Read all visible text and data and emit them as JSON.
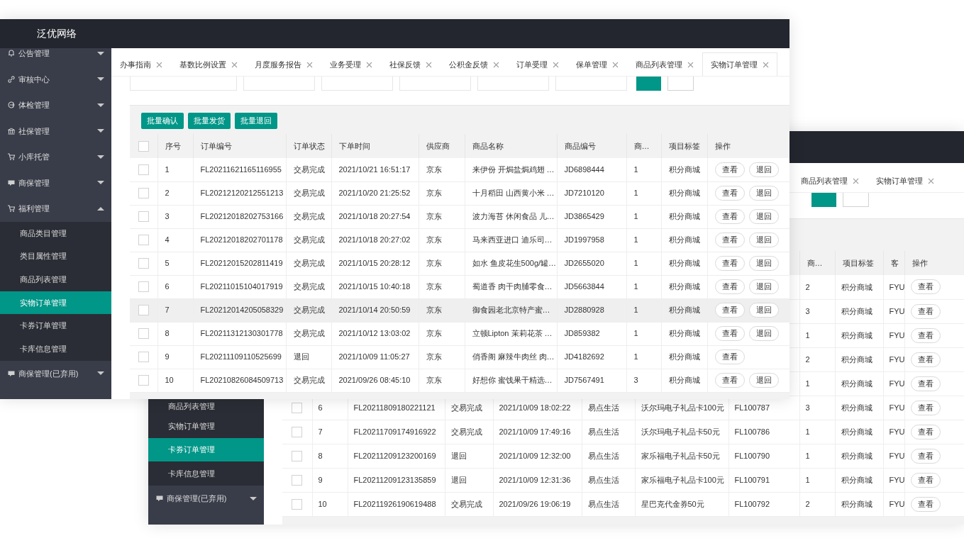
{
  "front_window": {
    "title": "泛优网络",
    "sidebar": [
      {
        "label": "公告管理",
        "expanded": false,
        "selected": false
      },
      {
        "label": "审核中心",
        "expanded": false,
        "selected": false
      },
      {
        "label": "体检管理",
        "expanded": false,
        "selected": false
      },
      {
        "label": "社保管理",
        "expanded": false,
        "selected": false
      },
      {
        "label": "小库托管",
        "expanded": false,
        "selected": false
      },
      {
        "label": "商保管理",
        "expanded": false,
        "selected": false
      },
      {
        "label": "福利管理",
        "expanded": true,
        "selected": false,
        "children": [
          {
            "label": "商品类目管理",
            "selected": false
          },
          {
            "label": "类目属性管理",
            "selected": false
          },
          {
            "label": "商品列表管理",
            "selected": false
          },
          {
            "label": "实物订单管理",
            "selected": true
          },
          {
            "label": "卡券订单管理",
            "selected": false
          },
          {
            "label": "卡库信息管理",
            "selected": false
          }
        ]
      },
      {
        "label": "商保管理(已弃用)",
        "expanded": false,
        "selected": false
      }
    ],
    "tabs": [
      {
        "label": "办事指南",
        "selected": false
      },
      {
        "label": "基数比例设置",
        "selected": false
      },
      {
        "label": "月度服务报告",
        "selected": false
      },
      {
        "label": "业务受理",
        "selected": false
      },
      {
        "label": "社保反馈",
        "selected": false
      },
      {
        "label": "公积金反馈",
        "selected": false
      },
      {
        "label": "订单受理",
        "selected": false
      },
      {
        "label": "保单管理",
        "selected": false
      },
      {
        "label": "商品列表管理",
        "selected": false
      },
      {
        "label": "实物订单管理",
        "selected": true
      }
    ],
    "toolbar": [
      "批量确认",
      "批量发货",
      "批量退回"
    ],
    "table": {
      "select_all_checked": false,
      "columns": [
        "序号",
        "订单编号",
        "订单状态",
        "下单时间",
        "供应商",
        "商品名称",
        "商品编号",
        "商…",
        "项目标签",
        "操作"
      ],
      "rows": [
        {
          "checked": false,
          "highlighted": false,
          "cells": [
            "1",
            "FL20211621165116955",
            "交易完成",
            "2021/10/21 16:51:17",
            "京东",
            "来伊份 开焗盐焗鸡翅 …",
            "JD6898444",
            "1",
            "积分商城"
          ],
          "actions": [
            "查看",
            "退回"
          ]
        },
        {
          "checked": false,
          "highlighted": false,
          "cells": [
            "2",
            "FL20212120212551213",
            "交易完成",
            "2021/10/20 21:25:52",
            "京东",
            "十月稻田 山西黄小米 …",
            "JD7210120",
            "1",
            "积分商城"
          ],
          "actions": [
            "查看",
            "退回"
          ]
        },
        {
          "checked": false,
          "highlighted": false,
          "cells": [
            "3",
            "FL20212018202753166",
            "交易完成",
            "2021/10/18 20:27:54",
            "京东",
            "波力海苔 休闲食品 儿…",
            "JD3865429",
            "1",
            "积分商城"
          ],
          "actions": [
            "查看",
            "退回"
          ]
        },
        {
          "checked": false,
          "highlighted": false,
          "cells": [
            "4",
            "FL20212018202701178",
            "交易完成",
            "2021/10/18 20:27:02",
            "京东",
            "马来西亚进口 迪乐司…",
            "JD1997958",
            "1",
            "积分商城"
          ],
          "actions": [
            "查看",
            "退回"
          ]
        },
        {
          "checked": false,
          "highlighted": false,
          "cells": [
            "5",
            "FL20212015202811419",
            "交易完成",
            "2021/10/15 20:28:12",
            "京东",
            "如水 鱼皮花生500g/罐…",
            "JD2655020",
            "1",
            "积分商城"
          ],
          "actions": [
            "查看",
            "退回"
          ]
        },
        {
          "checked": false,
          "highlighted": false,
          "cells": [
            "6",
            "FL20211015104017919",
            "交易完成",
            "2021/10/15 10:40:18",
            "京东",
            "蜀道香 肉干肉脯零食…",
            "JD5663844",
            "1",
            "积分商城"
          ],
          "actions": [
            "查看",
            "退回"
          ]
        },
        {
          "checked": false,
          "highlighted": true,
          "cells": [
            "7",
            "FL20212014205058329",
            "交易完成",
            "2021/10/14 20:50:59",
            "京东",
            "御食园老北京特产蜜…",
            "JD2880928",
            "1",
            "积分商城"
          ],
          "actions": [
            "查看",
            "退回"
          ]
        },
        {
          "checked": false,
          "highlighted": false,
          "cells": [
            "8",
            "FL20211312130301778",
            "交易完成",
            "2021/10/12 13:03:02",
            "京东",
            "立顿Lipton 茉莉花茶 …",
            "JD859382",
            "1",
            "积分商城"
          ],
          "actions": [
            "查看",
            "退回"
          ]
        },
        {
          "checked": false,
          "highlighted": false,
          "cells": [
            "9",
            "FL20211109110525699",
            "退回",
            "2021/10/09 11:05:27",
            "京东",
            "俏香阁 麻辣牛肉丝 肉…",
            "JD4182692",
            "1",
            "积分商城"
          ],
          "actions": [
            "查看"
          ]
        },
        {
          "checked": false,
          "highlighted": false,
          "cells": [
            "10",
            "FL20210826084509713",
            "交易完成",
            "2021/09/26 08:45:10",
            "京东",
            "好想你 蜜饯果干精选…",
            "JD7567491",
            "3",
            "积分商城"
          ],
          "actions": [
            "查看",
            "退回"
          ]
        }
      ]
    }
  },
  "back_window": {
    "sidebar": [
      {
        "label": "商品列表管理",
        "kind": "subitem",
        "selected": false
      },
      {
        "label": "实物订单管理",
        "kind": "subitem",
        "selected": false
      },
      {
        "label": "卡券订单管理",
        "kind": "subitem",
        "selected": true
      },
      {
        "label": "卡库信息管理",
        "kind": "subitem",
        "selected": false
      },
      {
        "label": "商保管理(已弃用)",
        "kind": "group",
        "expanded": false,
        "selected": false
      }
    ],
    "tabs": [
      {
        "label": "商品列表管理",
        "selected": false
      },
      {
        "label": "实物订单管理",
        "selected": false
      }
    ],
    "table": {
      "columns": [
        "商…",
        "项目标签",
        "客",
        "操作"
      ],
      "rows": [
        {
          "cells": [
            "2",
            "积分商城",
            "FYU"
          ],
          "actions": [
            "查看"
          ]
        },
        {
          "cells": [
            "3",
            "积分商城",
            "FYU"
          ],
          "actions": [
            "查看"
          ]
        },
        {
          "cells": [
            "1",
            "积分商城",
            "FYU"
          ],
          "actions": [
            "查看"
          ]
        },
        {
          "cells": [
            "2",
            "积分商城",
            "FYU"
          ],
          "actions": [
            "查看"
          ]
        },
        {
          "cells": [
            "1",
            "积分商城",
            "FYU"
          ],
          "actions": [
            "查看"
          ]
        },
        {
          "checked": false,
          "cells": [
            "6",
            "FL20211809180221121",
            "交易完成",
            "2021/10/09 18:02:22",
            "易点生活",
            "沃尔玛电子礼品卡100元",
            "FL100787",
            "3",
            "积分商城",
            "FYU"
          ],
          "actions": [
            "查看"
          ]
        },
        {
          "checked": false,
          "cells": [
            "7",
            "FL20211709174916922",
            "交易完成",
            "2021/10/09 17:49:16",
            "易点生活",
            "沃尔玛电子礼品卡50元",
            "FL100786",
            "1",
            "积分商城",
            "FYU"
          ],
          "actions": [
            "查看"
          ]
        },
        {
          "checked": false,
          "cells": [
            "8",
            "FL20211209123200169",
            "退回",
            "2021/10/09 12:32:00",
            "易点生活",
            "家乐福电子礼品卡50元",
            "FL100790",
            "1",
            "积分商城",
            "FYU"
          ],
          "actions": [
            "查看"
          ]
        },
        {
          "checked": false,
          "cells": [
            "9",
            "FL20211209123135859",
            "退回",
            "2021/10/09 12:31:36",
            "易点生活",
            "家乐福电子礼品卡100元",
            "FL100791",
            "1",
            "积分商城",
            "FYU"
          ],
          "actions": [
            "查看"
          ]
        },
        {
          "checked": false,
          "cells": [
            "10",
            "FL20211926190619488",
            "交易完成",
            "2021/09/26 19:06:19",
            "易点生活",
            "星巴克代金券50元",
            "FL100792",
            "2",
            "积分商城",
            "FYU"
          ],
          "actions": [
            "查看"
          ]
        }
      ]
    }
  }
}
